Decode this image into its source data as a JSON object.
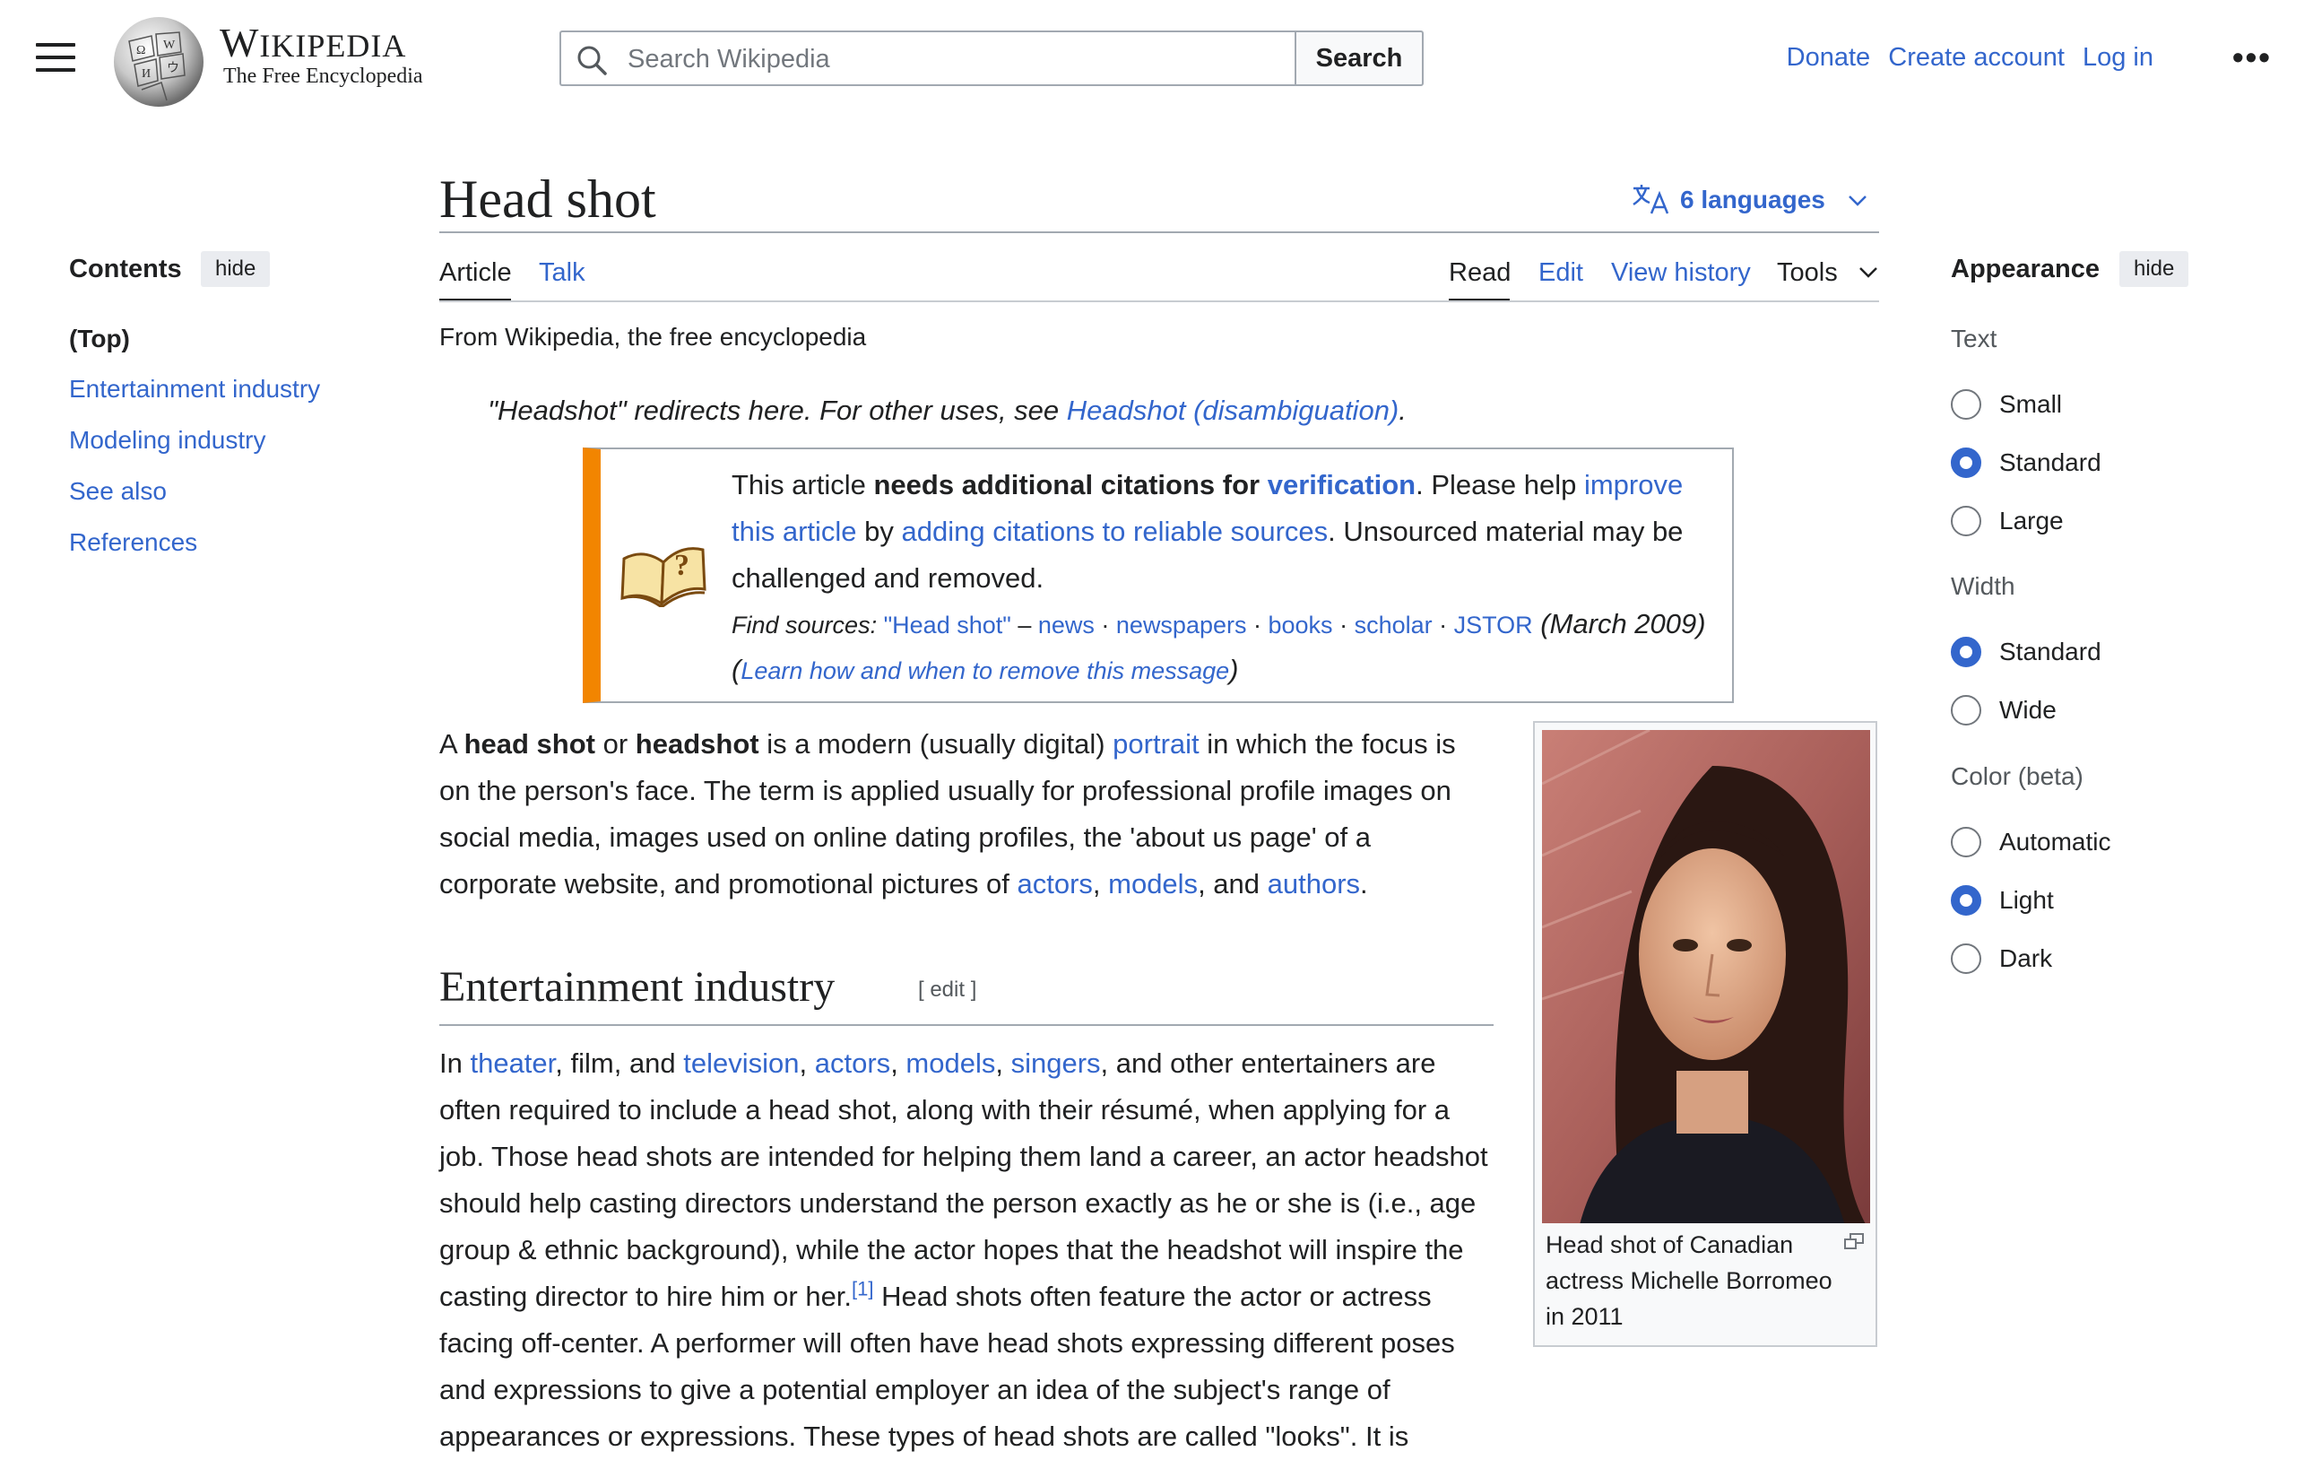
{
  "header": {
    "wordmark_first": "W",
    "wordmark_rest": "IKIPEDIA",
    "tagline": "The Free Encyclopedia",
    "search_placeholder": "Search Wikipedia",
    "search_button": "Search",
    "donate": "Donate",
    "create_account": "Create account",
    "log_in": "Log in",
    "more_icon": "ellipsis-icon"
  },
  "toc": {
    "title": "Contents",
    "hide": "hide",
    "top": "(Top)",
    "items": [
      "Entertainment industry",
      "Modeling industry",
      "See also",
      "References"
    ]
  },
  "page": {
    "title": "Head shot",
    "languages": "6 languages",
    "tabs": {
      "article": "Article",
      "talk": "Talk",
      "read": "Read",
      "edit": "Edit",
      "history": "View history",
      "tools": "Tools"
    },
    "from": "From Wikipedia, the free encyclopedia",
    "hatnote": {
      "prefix": "\"Headshot\" redirects here. For other uses, see ",
      "link": "Headshot (disambiguation)",
      "suffix": "."
    }
  },
  "ambox": {
    "t1": "This article ",
    "t2": "needs additional citations for ",
    "t3": "verification",
    "t4": ". Please help ",
    "t5": "improve this article",
    "t6": " by ",
    "t7": "adding citations to reliable sources",
    "t8": ". Unsourced material may be challenged and removed.",
    "find_label": "Find sources: ",
    "src_query": "\"Head shot\"",
    "dash": " – ",
    "src_news": "news",
    "src_newspapers": "newspapers",
    "src_books": "books",
    "src_scholar": "scholar",
    "src_jstor": "JSTOR",
    "sep": " · ",
    "date": " (March 2009) (",
    "learn": "Learn how and when to remove this message",
    "close_paren": ")"
  },
  "intro": {
    "p1": "A ",
    "b1": "head shot",
    "p2": " or ",
    "b2": "headshot",
    "p3": " is a modern (usually digital) ",
    "l1": "portrait",
    "p4": " in which the focus is on the person's face. The term is applied usually for professional profile images on social media, images used on online dating profiles, the 'about us page' of a corporate website, and promotional pictures of ",
    "l2": "actors",
    "p5": ", ",
    "l3": "models",
    "p6": ", and ",
    "l4": "authors",
    "p7": "."
  },
  "section": {
    "heading": "Entertainment industry",
    "edit": "[ edit ]",
    "p1": "In ",
    "l1": "theater",
    "p2": ", film, and ",
    "l2": "television",
    "c1": ", ",
    "l3": "actors",
    "c2": ", ",
    "l4": "models",
    "c3": ", ",
    "l5": "singers",
    "p3": ", and other entertainers are often required to include a head shot, along with their résumé, when applying for a job. Those head shots are intended for helping them land a career, an actor headshot should help casting directors understand the person exactly as he or she is (i.e., age group & ethnic background), while the actor hopes that the headshot will inspire the casting director to hire him or her.",
    "ref": "[1]",
    "p4": " Head shots often feature the actor or actress facing off-center. A performer will often have head shots expressing different poses and expressions to give a potential employer an idea of the subject's range of appearances or expressions. These types of head shots are called \"looks\". It is"
  },
  "thumb": {
    "caption": "Head shot of Canadian actress Michelle Borromeo in 2011"
  },
  "appearance": {
    "title": "Appearance",
    "hide": "hide",
    "text_label": "Text",
    "text_options": [
      "Small",
      "Standard",
      "Large"
    ],
    "width_label": "Width",
    "width_options": [
      "Standard",
      "Wide"
    ],
    "color_label": "Color (beta)",
    "color_options": [
      "Automatic",
      "Light",
      "Dark"
    ]
  },
  "colors": {
    "link": "#3366cc",
    "warning_bar": "#f28500",
    "text": "#202122"
  }
}
